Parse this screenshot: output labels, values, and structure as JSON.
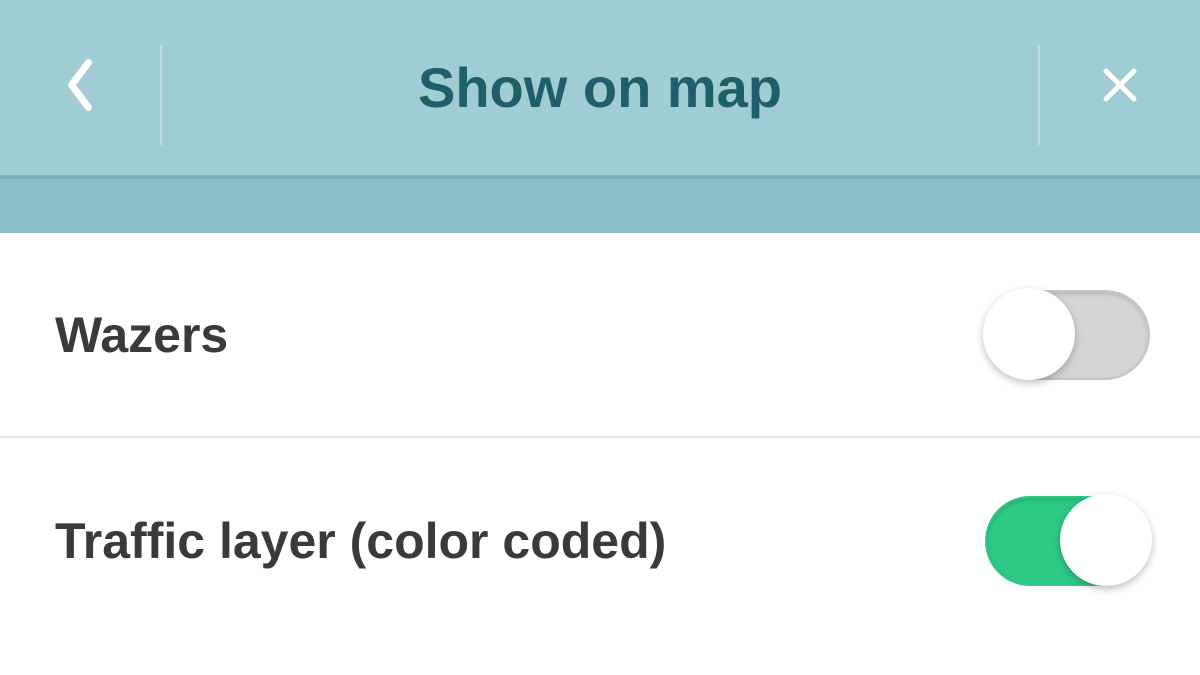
{
  "header": {
    "title": "Show on map",
    "back_icon": "chevron-left-icon",
    "close_icon": "close-icon"
  },
  "settings": [
    {
      "label": "Wazers",
      "enabled": false
    },
    {
      "label": "Traffic layer (color coded)",
      "enabled": true
    }
  ],
  "colors": {
    "header_bg": "#a0ccd3",
    "header_text": "#1f5f6b",
    "sub_header_bg": "#8dbec7",
    "toggle_on": "#2ec986",
    "toggle_off": "#d4d6d5",
    "text": "#3a3a3a"
  }
}
